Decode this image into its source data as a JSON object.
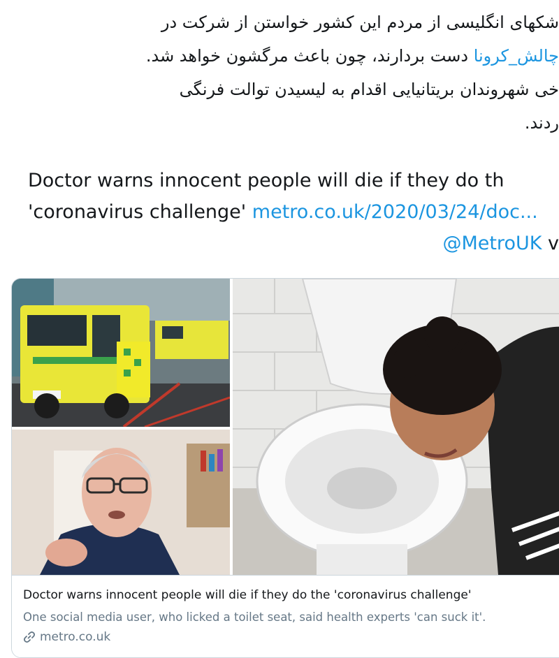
{
  "tweet": {
    "persian_lines": [
      {
        "text": "شکهای انگلیسی از مردم این کشور خواستن از شرکت در"
      },
      {
        "hashtag": "چالش_کرونا",
        "text": " دست بردارند، چون باعث مرگشون خواهد شد."
      },
      {
        "text": "خی شهروندان بریتانیایی اقدام به لیسیدن توالت فرنگی"
      },
      {
        "text": "ردند."
      }
    ],
    "english": {
      "line1": "Doctor warns innocent people will die if they do th",
      "line2_text": "'coronavirus challenge' ",
      "line2_link": "metro.co.uk/2020/03/24/doc...",
      "line3_mention": "@MetroUK",
      "line3_suffix": " v"
    }
  },
  "card": {
    "images": {
      "ambulance": "ambulance-photo",
      "man": "man-photo",
      "toilet": "toilet-photo"
    },
    "title": "Doctor warns innocent people will die if they do the 'coronavirus challenge'",
    "description": "One social media user, who licked a toilet seat, said health experts 'can suck it'.",
    "domain": "metro.co.uk",
    "domain_icon": "link-icon"
  },
  "colors": {
    "link": "#1b95e0",
    "text": "#14171a",
    "secondary": "#657786",
    "border": "#ccd6dd"
  }
}
